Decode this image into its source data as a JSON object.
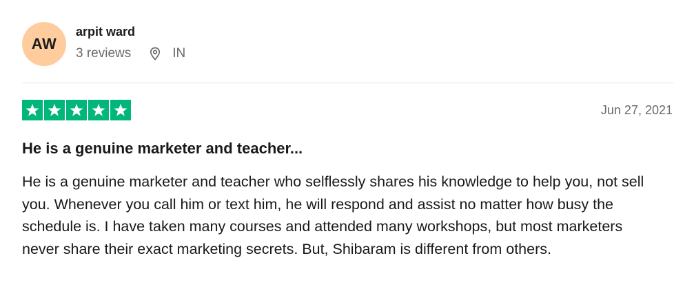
{
  "reviewer": {
    "initials": "AW",
    "name": "arpit ward",
    "review_count": "3 reviews",
    "country": "IN",
    "avatar_color": "#ffcc9e"
  },
  "review": {
    "rating": 5,
    "max_rating": 5,
    "star_color": "#00b67a",
    "date": "Jun 27, 2021",
    "title": "He is a genuine marketer and teacher...",
    "body": "He is a genuine marketer and teacher who selflessly shares his knowledge to help you, not sell you. Whenever you call him or text him, he will respond and assist no matter how busy the schedule is. I have taken many courses and attended many workshops, but most marketers never share their exact marketing secrets. But, Shibaram is different from others."
  },
  "icons": {
    "location": "location-pin-icon",
    "star": "star-icon"
  }
}
